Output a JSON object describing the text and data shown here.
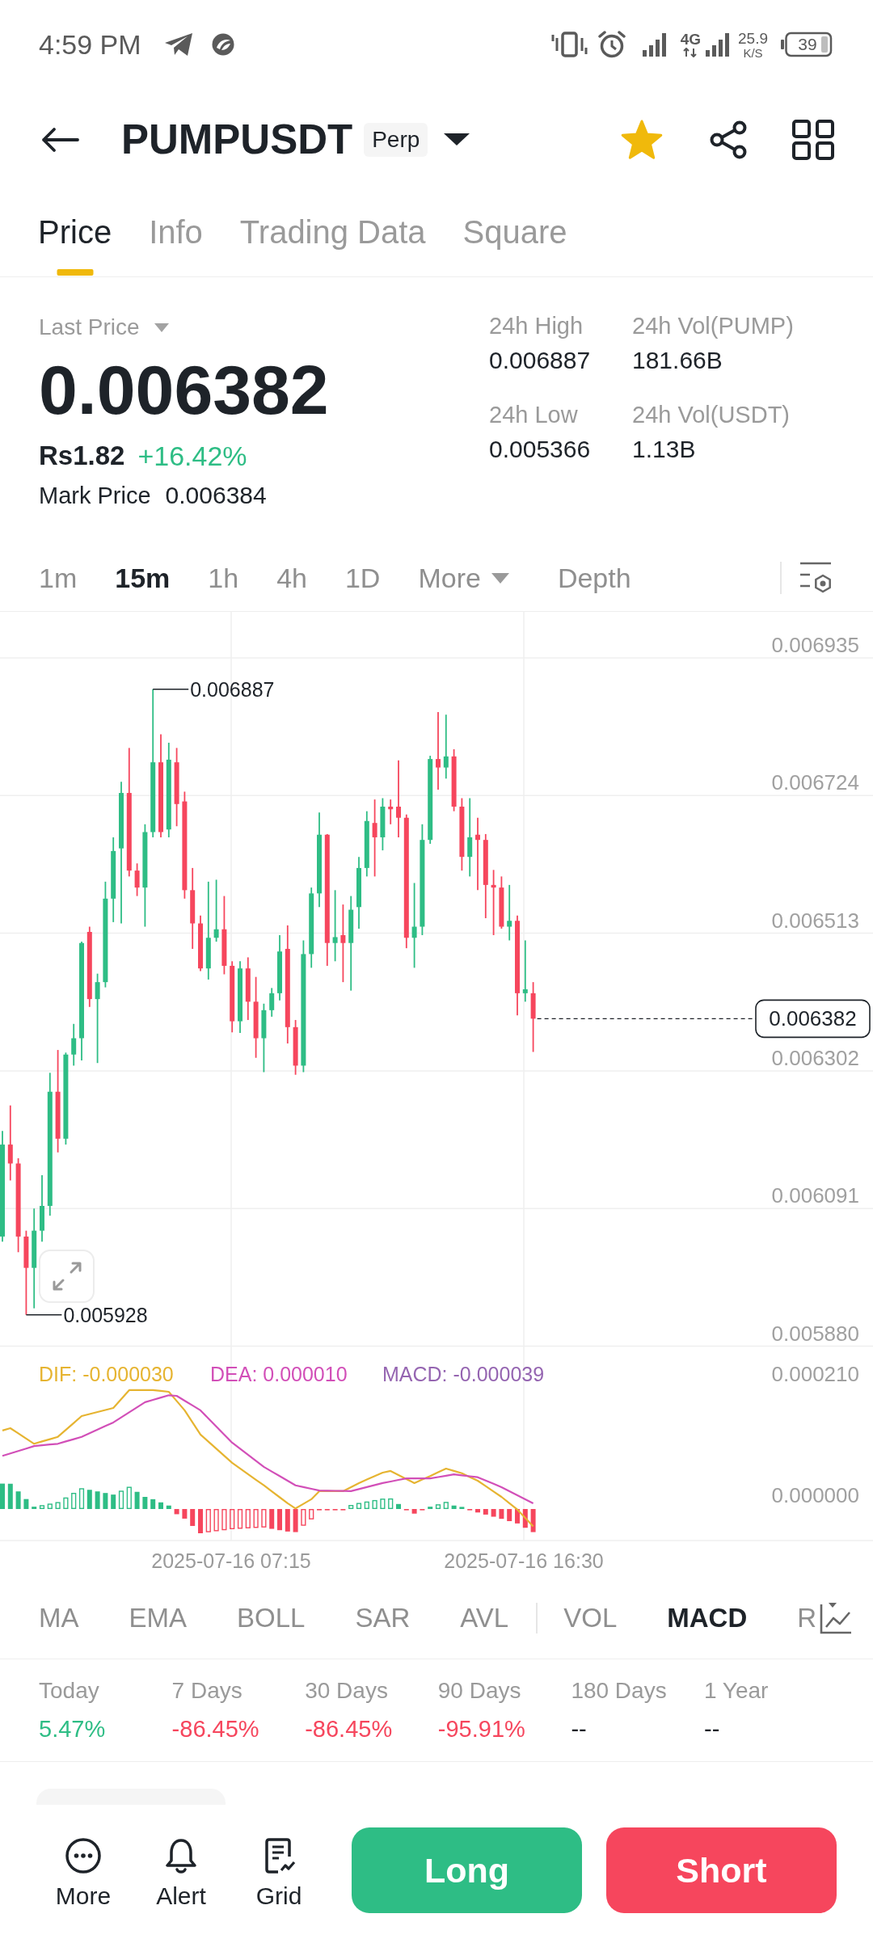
{
  "status_bar": {
    "time": "4:59 PM",
    "network": "4G",
    "speed": "25.9",
    "speed_unit": "K/S",
    "battery": "39"
  },
  "header": {
    "symbol": "PUMPUSDT",
    "badge": "Perp",
    "favorite": true
  },
  "tabs": [
    {
      "label": "Price",
      "selected": true
    },
    {
      "label": "Info",
      "selected": false
    },
    {
      "label": "Trading Data",
      "selected": false
    },
    {
      "label": "Square",
      "selected": false
    }
  ],
  "price_panel": {
    "price_type": "Last Price",
    "last_price": "0.006382",
    "local_price": "Rs1.82",
    "change": "+16.42%",
    "change_up": true,
    "mark_price_label": "Mark Price",
    "mark_price": "0.006384",
    "stats": [
      {
        "label": "24h High",
        "value": "0.006887"
      },
      {
        "label": "24h Vol(PUMP)",
        "value": "181.66B"
      },
      {
        "label": "24h Low",
        "value": "0.005366"
      },
      {
        "label": "24h Vol(USDT)",
        "value": "1.13B"
      }
    ]
  },
  "intervals": [
    {
      "label": "1m",
      "selected": false,
      "kind": "option"
    },
    {
      "label": "15m",
      "selected": true,
      "kind": "option"
    },
    {
      "label": "1h",
      "selected": false,
      "kind": "option"
    },
    {
      "label": "4h",
      "selected": false,
      "kind": "option"
    },
    {
      "label": "1D",
      "selected": false,
      "kind": "option"
    },
    {
      "label": "More",
      "selected": false,
      "kind": "dropdown"
    },
    {
      "label": "Depth",
      "selected": false,
      "kind": "view"
    }
  ],
  "chart": {
    "price_axis": [
      "0.006935",
      "0.006724",
      "0.006513",
      "0.006302",
      "0.006091",
      "0.005880"
    ],
    "high_label": "0.006887",
    "low_label": "0.005928",
    "current_price": "0.006382",
    "macd_legend": [
      {
        "label": "DIF: -0.000030",
        "color": "#e6b431"
      },
      {
        "label": "DEA: 0.000010",
        "color": "#d24fb8"
      },
      {
        "label": "MACD: -0.000039",
        "color": "#9565b1"
      }
    ],
    "macd_axis": [
      "0.000210",
      "0.000000"
    ],
    "time_axis": [
      "2025-07-16 07:15",
      "2025-07-16 16:30"
    ]
  },
  "indicators": {
    "main": [
      {
        "label": "MA",
        "selected": false
      },
      {
        "label": "EMA",
        "selected": false
      },
      {
        "label": "BOLL",
        "selected": false
      },
      {
        "label": "SAR",
        "selected": false
      },
      {
        "label": "AVL",
        "selected": false
      }
    ],
    "sub": [
      {
        "label": "VOL",
        "selected": false
      },
      {
        "label": "MACD",
        "selected": true
      },
      {
        "label": "R",
        "selected": false
      }
    ]
  },
  "performance": [
    {
      "label": "Today",
      "value": "5.47%",
      "kind": "gain"
    },
    {
      "label": "7 Days",
      "value": "-86.45%",
      "kind": "loss"
    },
    {
      "label": "30 Days",
      "value": "-86.45%",
      "kind": "loss"
    },
    {
      "label": "90 Days",
      "value": "-95.91%",
      "kind": "loss"
    },
    {
      "label": "180 Days",
      "value": "--",
      "kind": "empty"
    },
    {
      "label": "1 Year",
      "value": "--",
      "kind": "empty"
    }
  ],
  "toolbar": [
    {
      "label": "More",
      "kind": "more"
    },
    {
      "label": "Alert",
      "kind": "alert"
    },
    {
      "label": "Grid",
      "kind": "grid"
    }
  ],
  "trade_buttons": [
    {
      "label": "Long",
      "kind": "long"
    },
    {
      "label": "Short",
      "kind": "short"
    }
  ]
}
